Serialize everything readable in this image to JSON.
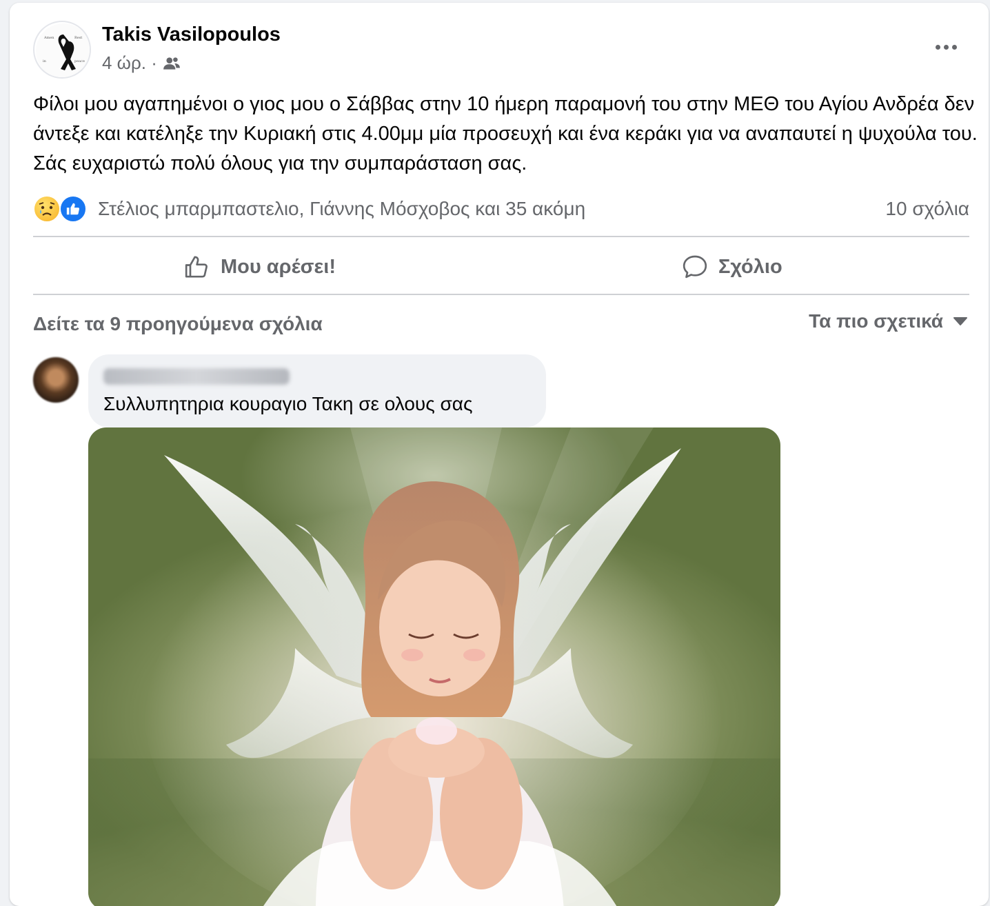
{
  "post": {
    "author": "Takis Vasilopoulos",
    "time": "4 ώρ. ·",
    "audience_icon": "friends-icon",
    "text": "Φίλοι μου αγαπημένοι ο γιος μου ο Σάββας στην 10 ήμερη παραμονή του στην ΜΕΘ του Αγίου Ανδρέα δεν άντεξε και κατέληξε την Κυριακή στις 4.00μμ μία προσευχή και ένα κεράκι για να αναπαυτεί η ψυχούλα του. Σάς ευχαριστώ πολύ όλους για την συμπαράσταση σας.",
    "reactions": {
      "types": [
        "sad",
        "like"
      ],
      "names": "Στέλιος μπαρμπαστελιο, Γιάννης Μόσχοβος και 35 ακόμη"
    },
    "comment_count": "10 σχόλια"
  },
  "actions": {
    "like_label": "Μου αρέσει!",
    "comment_label": "Σχόλιο"
  },
  "comments": {
    "previous_label": "Δείτε τα 9 προηγούμενα σχόλια",
    "sort_label": "Τα πιο σχετικά",
    "items": [
      {
        "author_blurred": true,
        "text": "Συλλυπητηρια κουραγιο Τακη σε ολους σας",
        "has_image": true
      }
    ]
  },
  "colors": {
    "primary_text": "#050505",
    "secondary_text": "#65676b",
    "like_blue": "#1877f2",
    "bubble_bg": "#f0f2f5"
  }
}
